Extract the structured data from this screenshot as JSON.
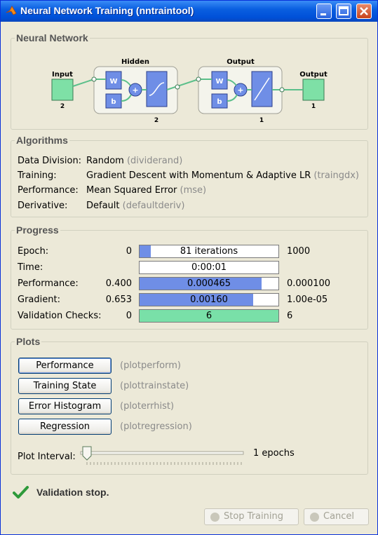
{
  "window": {
    "title": "Neural Network Training (nntraintool)",
    "accent": "#0a5fe0"
  },
  "network": {
    "section_title": "Neural Network",
    "input_label": "Input",
    "input_size": "2",
    "hidden_label": "Hidden",
    "hidden_size": "2",
    "output_layer_label": "Output",
    "output_layer_size": "1",
    "output_label": "Output",
    "output_size": "1",
    "weight_label": "W",
    "bias_label": "b",
    "sum_label": "+"
  },
  "algorithms": {
    "section_title": "Algorithms",
    "rows": [
      {
        "label": "Data Division:",
        "value": "Random",
        "fn": "(dividerand)"
      },
      {
        "label": "Training:",
        "value": "Gradient Descent with Momentum & Adaptive LR",
        "fn": "(traingdx)"
      },
      {
        "label": "Performance:",
        "value": "Mean Squared Error",
        "fn": "(mse)"
      },
      {
        "label": "Derivative:",
        "value": "Default",
        "fn": "(defaultderiv)"
      }
    ]
  },
  "progress": {
    "section_title": "Progress",
    "bar_color": "#6f8ee6",
    "valid_color": "#79e0a8",
    "rows": [
      {
        "label": "Epoch:",
        "start": "0",
        "text": "81 iterations",
        "end": "1000",
        "fraction": 0.081
      },
      {
        "label": "Time:",
        "start": "",
        "text": "0:00:01",
        "end": "",
        "fraction": 0
      },
      {
        "label": "Performance:",
        "start": "0.400",
        "text": "0.000465",
        "end": "0.000100",
        "fraction": 0.88
      },
      {
        "label": "Gradient:",
        "start": "0.653",
        "text": "0.00160",
        "end": "1.00e-05",
        "fraction": 0.82
      },
      {
        "label": "Validation Checks:",
        "start": "0",
        "text": "6",
        "end": "6",
        "fraction": 1.0
      }
    ]
  },
  "plots": {
    "section_title": "Plots",
    "buttons": [
      {
        "label": "Performance",
        "fn": "(plotperform)"
      },
      {
        "label": "Training State",
        "fn": "(plottrainstate)"
      },
      {
        "label": "Error Histogram",
        "fn": "(ploterrhist)"
      },
      {
        "label": "Regression",
        "fn": "(plotregression)"
      }
    ],
    "interval_label": "Plot Interval:",
    "interval_value": "1 epochs"
  },
  "status": {
    "icon": "checkmark-icon",
    "text": "Validation stop."
  },
  "footer": {
    "stop_label": "Stop Training",
    "cancel_label": "Cancel"
  }
}
